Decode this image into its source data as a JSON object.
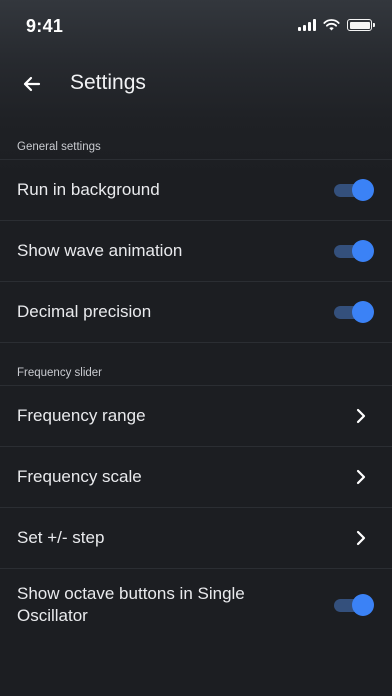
{
  "status_bar": {
    "time": "9:41",
    "icons": [
      "signal-icon",
      "wifi-icon",
      "battery-icon"
    ]
  },
  "header": {
    "back_icon": "arrow-left-icon",
    "title": "Settings"
  },
  "sections": {
    "general": {
      "title": "General settings",
      "items": [
        {
          "label": "Run in background",
          "control": "toggle",
          "on": true
        },
        {
          "label": "Show wave animation",
          "control": "toggle",
          "on": true
        },
        {
          "label": "Decimal precision",
          "control": "toggle",
          "on": true
        }
      ]
    },
    "frequency": {
      "title": "Frequency slider",
      "items": [
        {
          "label": "Frequency range",
          "control": "chevron-right-icon"
        },
        {
          "label": "Frequency scale",
          "control": "chevron-right-icon"
        },
        {
          "label": "Set +/- step",
          "control": "chevron-right-icon"
        },
        {
          "label": "Show octave buttons in Single Oscillator",
          "control": "toggle",
          "on": true
        }
      ]
    }
  },
  "colors": {
    "accent": "#3b82f6",
    "toggle_track": "#34507c",
    "background": "#1c1e22",
    "divider": "#2b2e33"
  }
}
